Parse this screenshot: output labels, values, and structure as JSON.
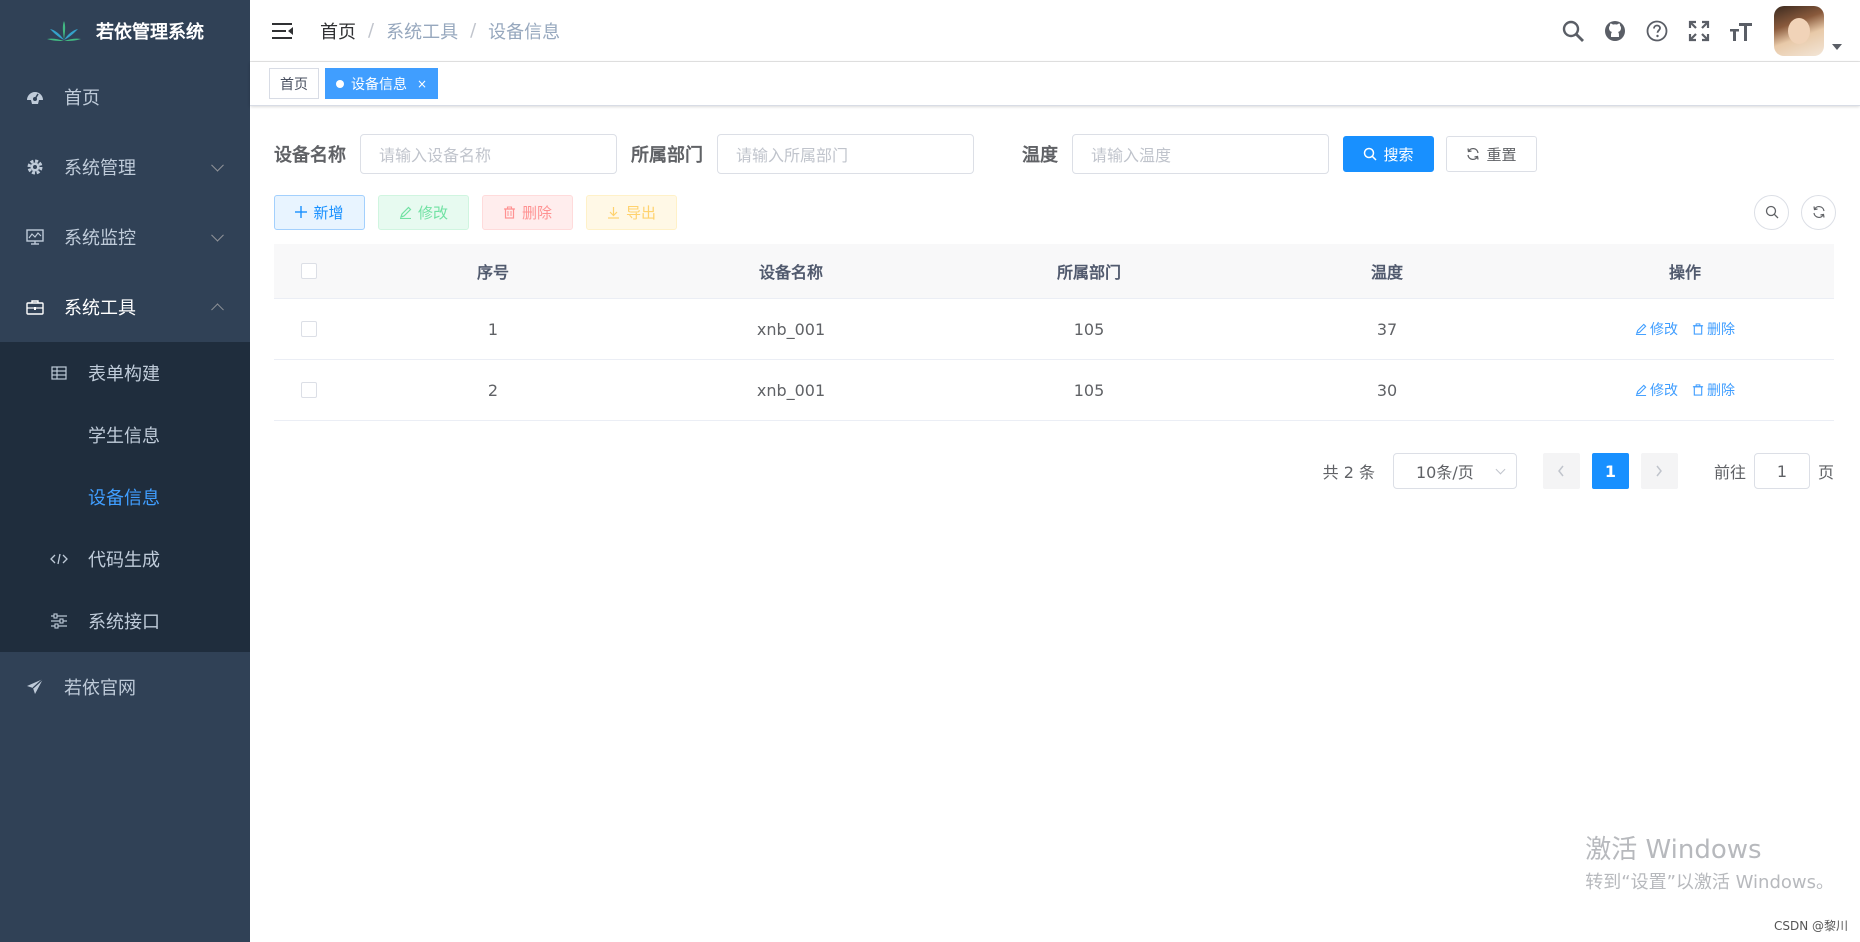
{
  "app": {
    "title": "若依管理系统"
  },
  "sidebar": {
    "items": [
      {
        "label": "首页"
      },
      {
        "label": "系统管理"
      },
      {
        "label": "系统监控"
      },
      {
        "label": "系统工具"
      }
    ],
    "submenu": [
      {
        "label": "表单构建"
      },
      {
        "label": "学生信息"
      },
      {
        "label": "设备信息"
      },
      {
        "label": "代码生成"
      },
      {
        "label": "系统接口"
      }
    ],
    "footer_item": {
      "label": "若依官网"
    }
  },
  "breadcrumb": [
    "首页",
    "系统工具",
    "设备信息"
  ],
  "tags": [
    {
      "label": "首页"
    },
    {
      "label": "设备信息",
      "close": "×"
    }
  ],
  "search": {
    "fields": [
      {
        "label": "设备名称",
        "placeholder": "请输入设备名称"
      },
      {
        "label": "所属部门",
        "placeholder": "请输入所属部门"
      },
      {
        "label": "温度",
        "placeholder": "请输入温度"
      }
    ],
    "search_label": "搜索",
    "reset_label": "重置"
  },
  "toolbar": {
    "add_label": "新增",
    "edit_label": "修改",
    "delete_label": "删除",
    "export_label": "导出"
  },
  "table": {
    "columns": [
      "序号",
      "设备名称",
      "所属部门",
      "温度",
      "操作"
    ],
    "rows": [
      {
        "index": "1",
        "name": "xnb_001",
        "dept": "105",
        "temp": "37",
        "edit": "修改",
        "delete": "删除"
      },
      {
        "index": "2",
        "name": "xnb_001",
        "dept": "105",
        "temp": "30",
        "edit": "修改",
        "delete": "删除"
      }
    ]
  },
  "pagination": {
    "total": "共 2 条",
    "page_size": "10条/页",
    "current": "1",
    "goto_label": "前往",
    "goto_value": "1",
    "page_suffix": "页"
  },
  "watermark": {
    "title": "激活 Windows",
    "subtitle": "转到“设置”以激活 Windows。",
    "csdn": "CSDN @黎川"
  },
  "colors": {
    "sidebar_bg": "#304156",
    "submenu_bg": "#1f2d3d",
    "primary": "#1890ff",
    "active_text": "#409eff"
  }
}
